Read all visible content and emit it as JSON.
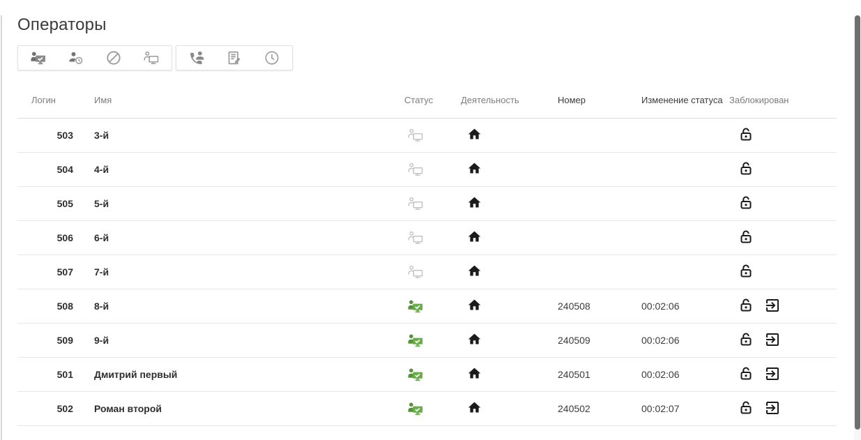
{
  "page": {
    "title": "Операторы"
  },
  "toolbar": {
    "groups": [
      {
        "buttons": [
          {
            "name": "set-status-ready-button",
            "icon": "operator-ready-icon"
          },
          {
            "name": "set-status-away-button",
            "icon": "operator-clock-icon"
          },
          {
            "name": "set-status-dnd-button",
            "icon": "block-icon"
          },
          {
            "name": "set-status-offline-button",
            "icon": "operator-offline-icon"
          }
        ]
      },
      {
        "buttons": [
          {
            "name": "call-operator-button",
            "icon": "phone-person-icon"
          },
          {
            "name": "edit-operator-button",
            "icon": "edit-document-icon"
          },
          {
            "name": "status-history-button",
            "icon": "clock-icon"
          }
        ]
      }
    ]
  },
  "table": {
    "columns": [
      "Логин",
      "Имя",
      "Статус",
      "Деятельность",
      "Номер",
      "Изменение статуса",
      "Заблокирован"
    ],
    "rows": [
      {
        "login": "503",
        "name": "3-й",
        "status": "offline",
        "activity": "home",
        "number": "",
        "status_change": "",
        "locked": false,
        "can_logout": false
      },
      {
        "login": "504",
        "name": "4-й",
        "status": "offline",
        "activity": "home",
        "number": "",
        "status_change": "",
        "locked": false,
        "can_logout": false
      },
      {
        "login": "505",
        "name": "5-й",
        "status": "offline",
        "activity": "home",
        "number": "",
        "status_change": "",
        "locked": false,
        "can_logout": false
      },
      {
        "login": "506",
        "name": "6-й",
        "status": "offline",
        "activity": "home",
        "number": "",
        "status_change": "",
        "locked": false,
        "can_logout": false
      },
      {
        "login": "507",
        "name": "7-й",
        "status": "offline",
        "activity": "home",
        "number": "",
        "status_change": "",
        "locked": false,
        "can_logout": false
      },
      {
        "login": "508",
        "name": "8-й",
        "status": "online",
        "activity": "home",
        "number": "240508",
        "status_change": "00:02:06",
        "locked": false,
        "can_logout": true
      },
      {
        "login": "509",
        "name": "9-й",
        "status": "online",
        "activity": "home",
        "number": "240509",
        "status_change": "00:02:06",
        "locked": false,
        "can_logout": true
      },
      {
        "login": "501",
        "name": "Дмитрий первый",
        "status": "online",
        "activity": "home",
        "number": "240501",
        "status_change": "00:02:06",
        "locked": false,
        "can_logout": true
      },
      {
        "login": "502",
        "name": "Роман второй",
        "status": "online",
        "activity": "home",
        "number": "240502",
        "status_change": "00:02:07",
        "locked": false,
        "can_logout": true
      }
    ]
  },
  "icons": {
    "status_online": "operator-online-icon",
    "status_offline": "operator-offline-icon",
    "activity_home": "home-icon",
    "blocked_open": "lock-open-icon",
    "logout": "logout-icon"
  },
  "colors": {
    "status_online_person": "#55923a",
    "status_online_screen": "#68ad49",
    "status_offline_gray": "#c4c4c4",
    "toolbar_icon_gray": "#8a8a8a",
    "header_text": "#7d7d7d",
    "row_icon_black": "#1b1b1b",
    "scroll_thumb": "#6f6f6f"
  }
}
